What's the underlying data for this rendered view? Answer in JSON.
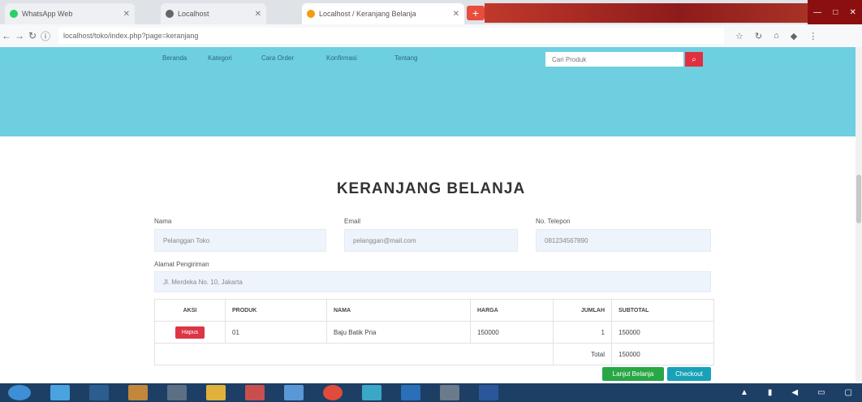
{
  "browser": {
    "tabs": [
      {
        "label": "WhatsApp Web",
        "color": "#25d366"
      },
      {
        "label": "Localhost",
        "color": "#666666"
      },
      {
        "label": "Localhost / Keranjang Belanja",
        "color": "#f39c12"
      }
    ],
    "new_tab_label": "+",
    "url": "localhost/toko/index.php?page=keranjang",
    "window_controls": [
      "—",
      "□",
      "✕"
    ]
  },
  "site": {
    "nav": [
      "Beranda",
      "Kategori",
      "Cara Order",
      "Konfirmasi",
      "Tentang"
    ],
    "search_placeholder": "Cari Produk",
    "search_icon": "search-icon"
  },
  "page_title": "KERANJANG BELANJA",
  "form": {
    "nama_label": "Nama",
    "nama_value": "Pelanggan Toko",
    "email_label": "Email",
    "email_value": "pelanggan@mail.com",
    "telp_label": "No. Telepon",
    "telp_value": "081234567890",
    "alamat_label": "Alamat Pengiriman",
    "alamat_value": "Jl. Merdeka No. 10, Jakarta"
  },
  "table": {
    "headers": [
      "AKSI",
      "PRODUK",
      "NAMA",
      "HARGA",
      "JUMLAH",
      "SUBTOTAL"
    ],
    "rows": [
      {
        "aksi": "Hapus",
        "produk": "01",
        "nama": "Baju Batik Pria",
        "harga": "150000",
        "jumlah": "1",
        "subtotal": "150000"
      }
    ],
    "total_label": "Total",
    "total_value": "150000"
  },
  "buttons": {
    "continue_label": "Lanjut Belanja",
    "checkout_label": "Checkout"
  },
  "colors": {
    "hero": "#6ecfe1",
    "accent_red": "#dc3545",
    "green": "#28a745",
    "teal": "#17a2b8"
  }
}
